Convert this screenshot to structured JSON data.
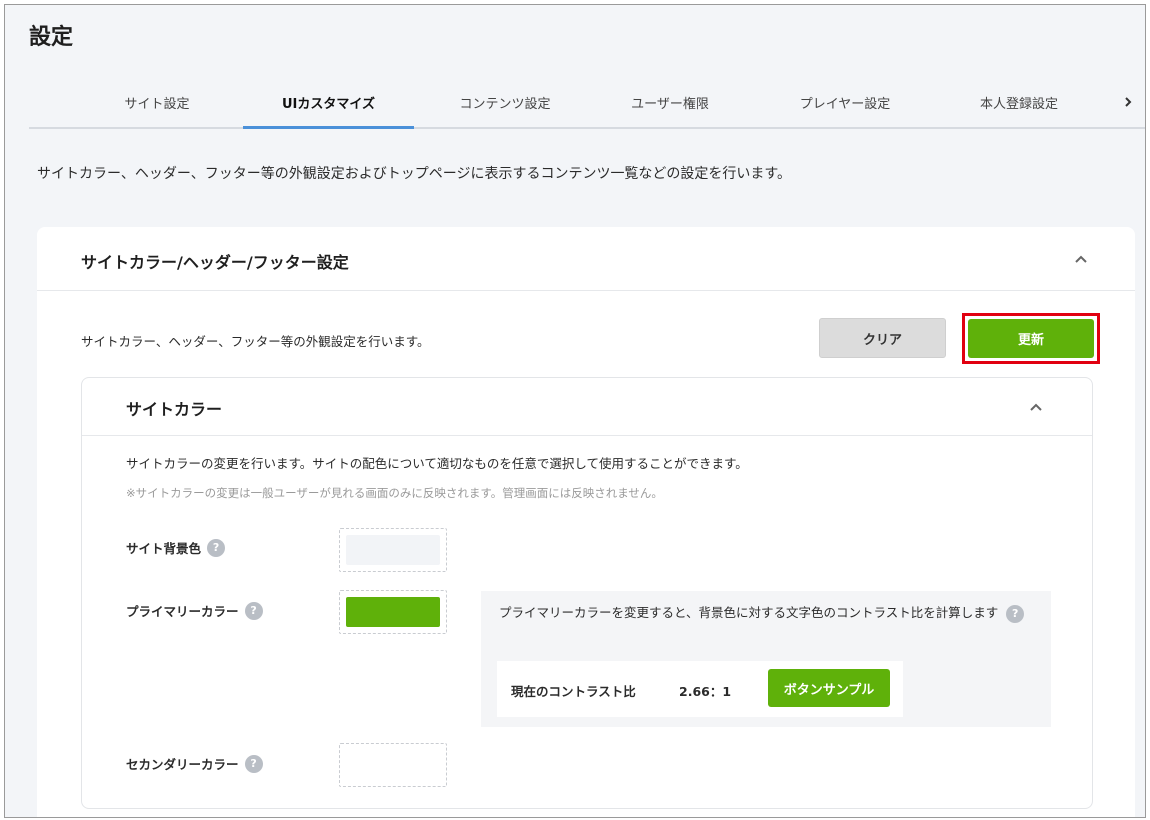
{
  "page": {
    "title": "設定",
    "description": "サイトカラー、ヘッダー、フッター等の外観設定およびトップページに表示するコンテンツ一覧などの設定を行います。"
  },
  "tabs": [
    {
      "label": "サイト設定"
    },
    {
      "label": "UIカスタマイズ",
      "active": true
    },
    {
      "label": "コンテンツ設定"
    },
    {
      "label": "ユーザー権限"
    },
    {
      "label": "プレイヤー設定"
    },
    {
      "label": "本人登録設定"
    }
  ],
  "tab_next_icon": "chevron-right-icon",
  "section": {
    "title": "サイトカラー/ヘッダー/フッター設定",
    "description": "サイトカラー、ヘッダー、フッター等の外観設定を行います。",
    "clear_label": "クリア",
    "update_label": "更新",
    "highlight_color": "#e10010"
  },
  "site_color": {
    "title": "サイトカラー",
    "description": "サイトカラーの変更を行います。サイトの配色について適切なものを任意で選択して使用することができます。",
    "note": "※サイトカラーの変更は一般ユーザーが見れる画面のみに反映されます。管理画面には反映されません。",
    "fields": [
      {
        "label": "サイト背景色",
        "color": "#f2f4f7"
      },
      {
        "label": "プライマリーカラー",
        "color": "#5fb10a"
      },
      {
        "label": "セカンダリーカラー",
        "color": "#ffffff"
      }
    ],
    "help_glyph": "?",
    "contrast": {
      "text": "プライマリーカラーを変更すると、背景色に対する文字色のコントラスト比を計算します",
      "ratio_label": "現在のコントラスト比",
      "ratio_value": "2.66：1",
      "sample_label": "ボタンサンプル"
    }
  },
  "colors": {
    "accent_blue": "#4a90d9",
    "primary_green": "#5fb10a",
    "clear_gray": "#dcdcdc"
  }
}
